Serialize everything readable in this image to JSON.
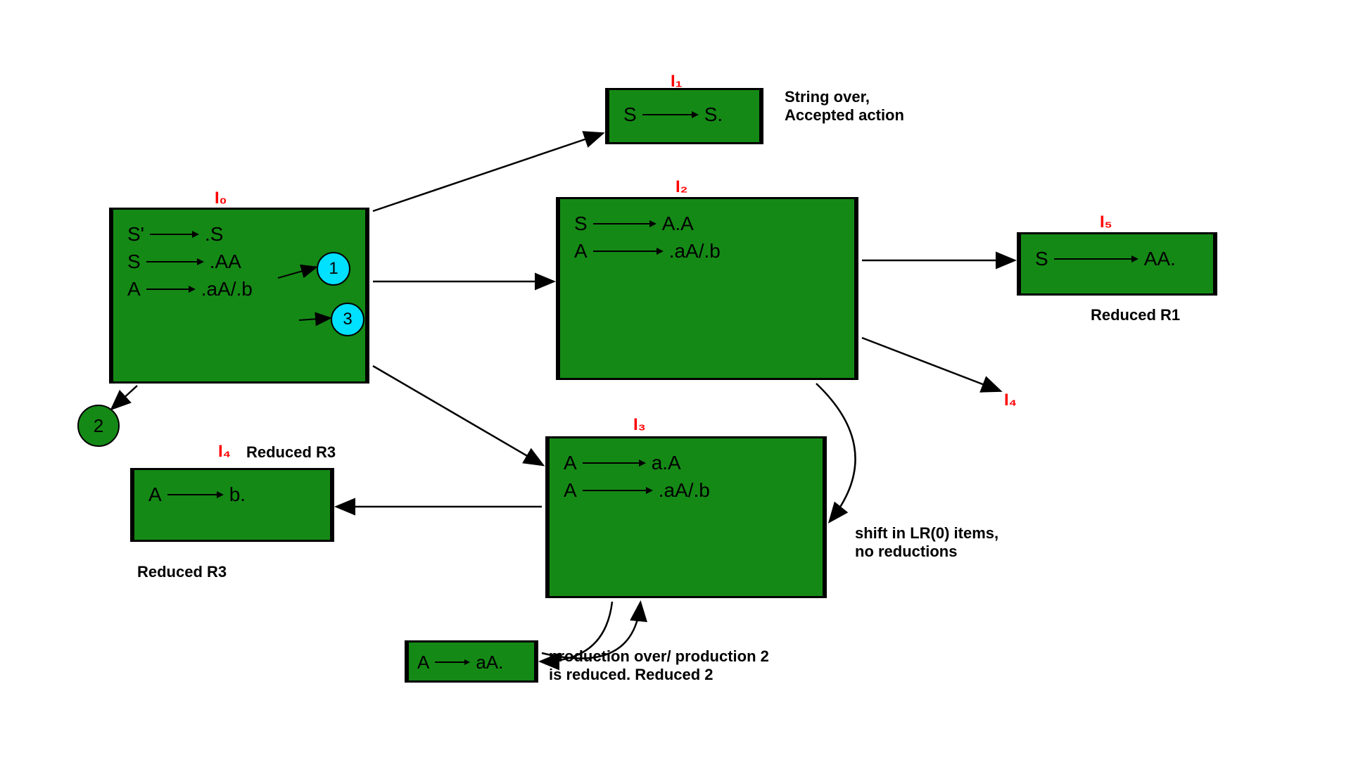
{
  "diagram_type": "LR(0) state transition / parse DFA",
  "states": {
    "I0": {
      "label": "I₀",
      "items": [
        {
          "lhs": "S'",
          "rhs": ".S"
        },
        {
          "lhs": "S",
          "rhs": ".AA"
        },
        {
          "lhs": "A",
          "rhs": ".aA/.b"
        }
      ],
      "circles": [
        {
          "text": "1",
          "color": "cyan"
        },
        {
          "text": "3",
          "color": "cyan"
        }
      ],
      "ext_circle": {
        "text": "2",
        "color": "green"
      }
    },
    "I1": {
      "label": "I₁",
      "items": [
        {
          "lhs": "S",
          "rhs": "S."
        }
      ],
      "annotation": "String over,\nAccepted action"
    },
    "I2": {
      "label": "I₂",
      "items": [
        {
          "lhs": "S",
          "rhs": "A.A"
        },
        {
          "lhs": "A",
          "rhs": ".aA/.b"
        }
      ]
    },
    "I3": {
      "label": "I₃",
      "items": [
        {
          "lhs": "A",
          "rhs": "a.A"
        },
        {
          "lhs": "A",
          "rhs": ".aA/.b"
        }
      ],
      "self_note": "production over/ production 2\nis reduced. Reduced 2",
      "side_note": "shift in LR(0) items,\nno reductions"
    },
    "I4": {
      "label": "I₄",
      "title": "Reduced R3",
      "items": [
        {
          "lhs": "A",
          "rhs": "b."
        }
      ],
      "bottom_note": "Reduced R3"
    },
    "I4_ref": {
      "label": "I₄"
    },
    "I5": {
      "label": "I₅",
      "items": [
        {
          "lhs": "S",
          "rhs": "AA."
        }
      ],
      "bottom_note": "Reduced R1"
    },
    "I6_small": {
      "items": [
        {
          "lhs": "A",
          "rhs": "aA."
        }
      ]
    }
  }
}
